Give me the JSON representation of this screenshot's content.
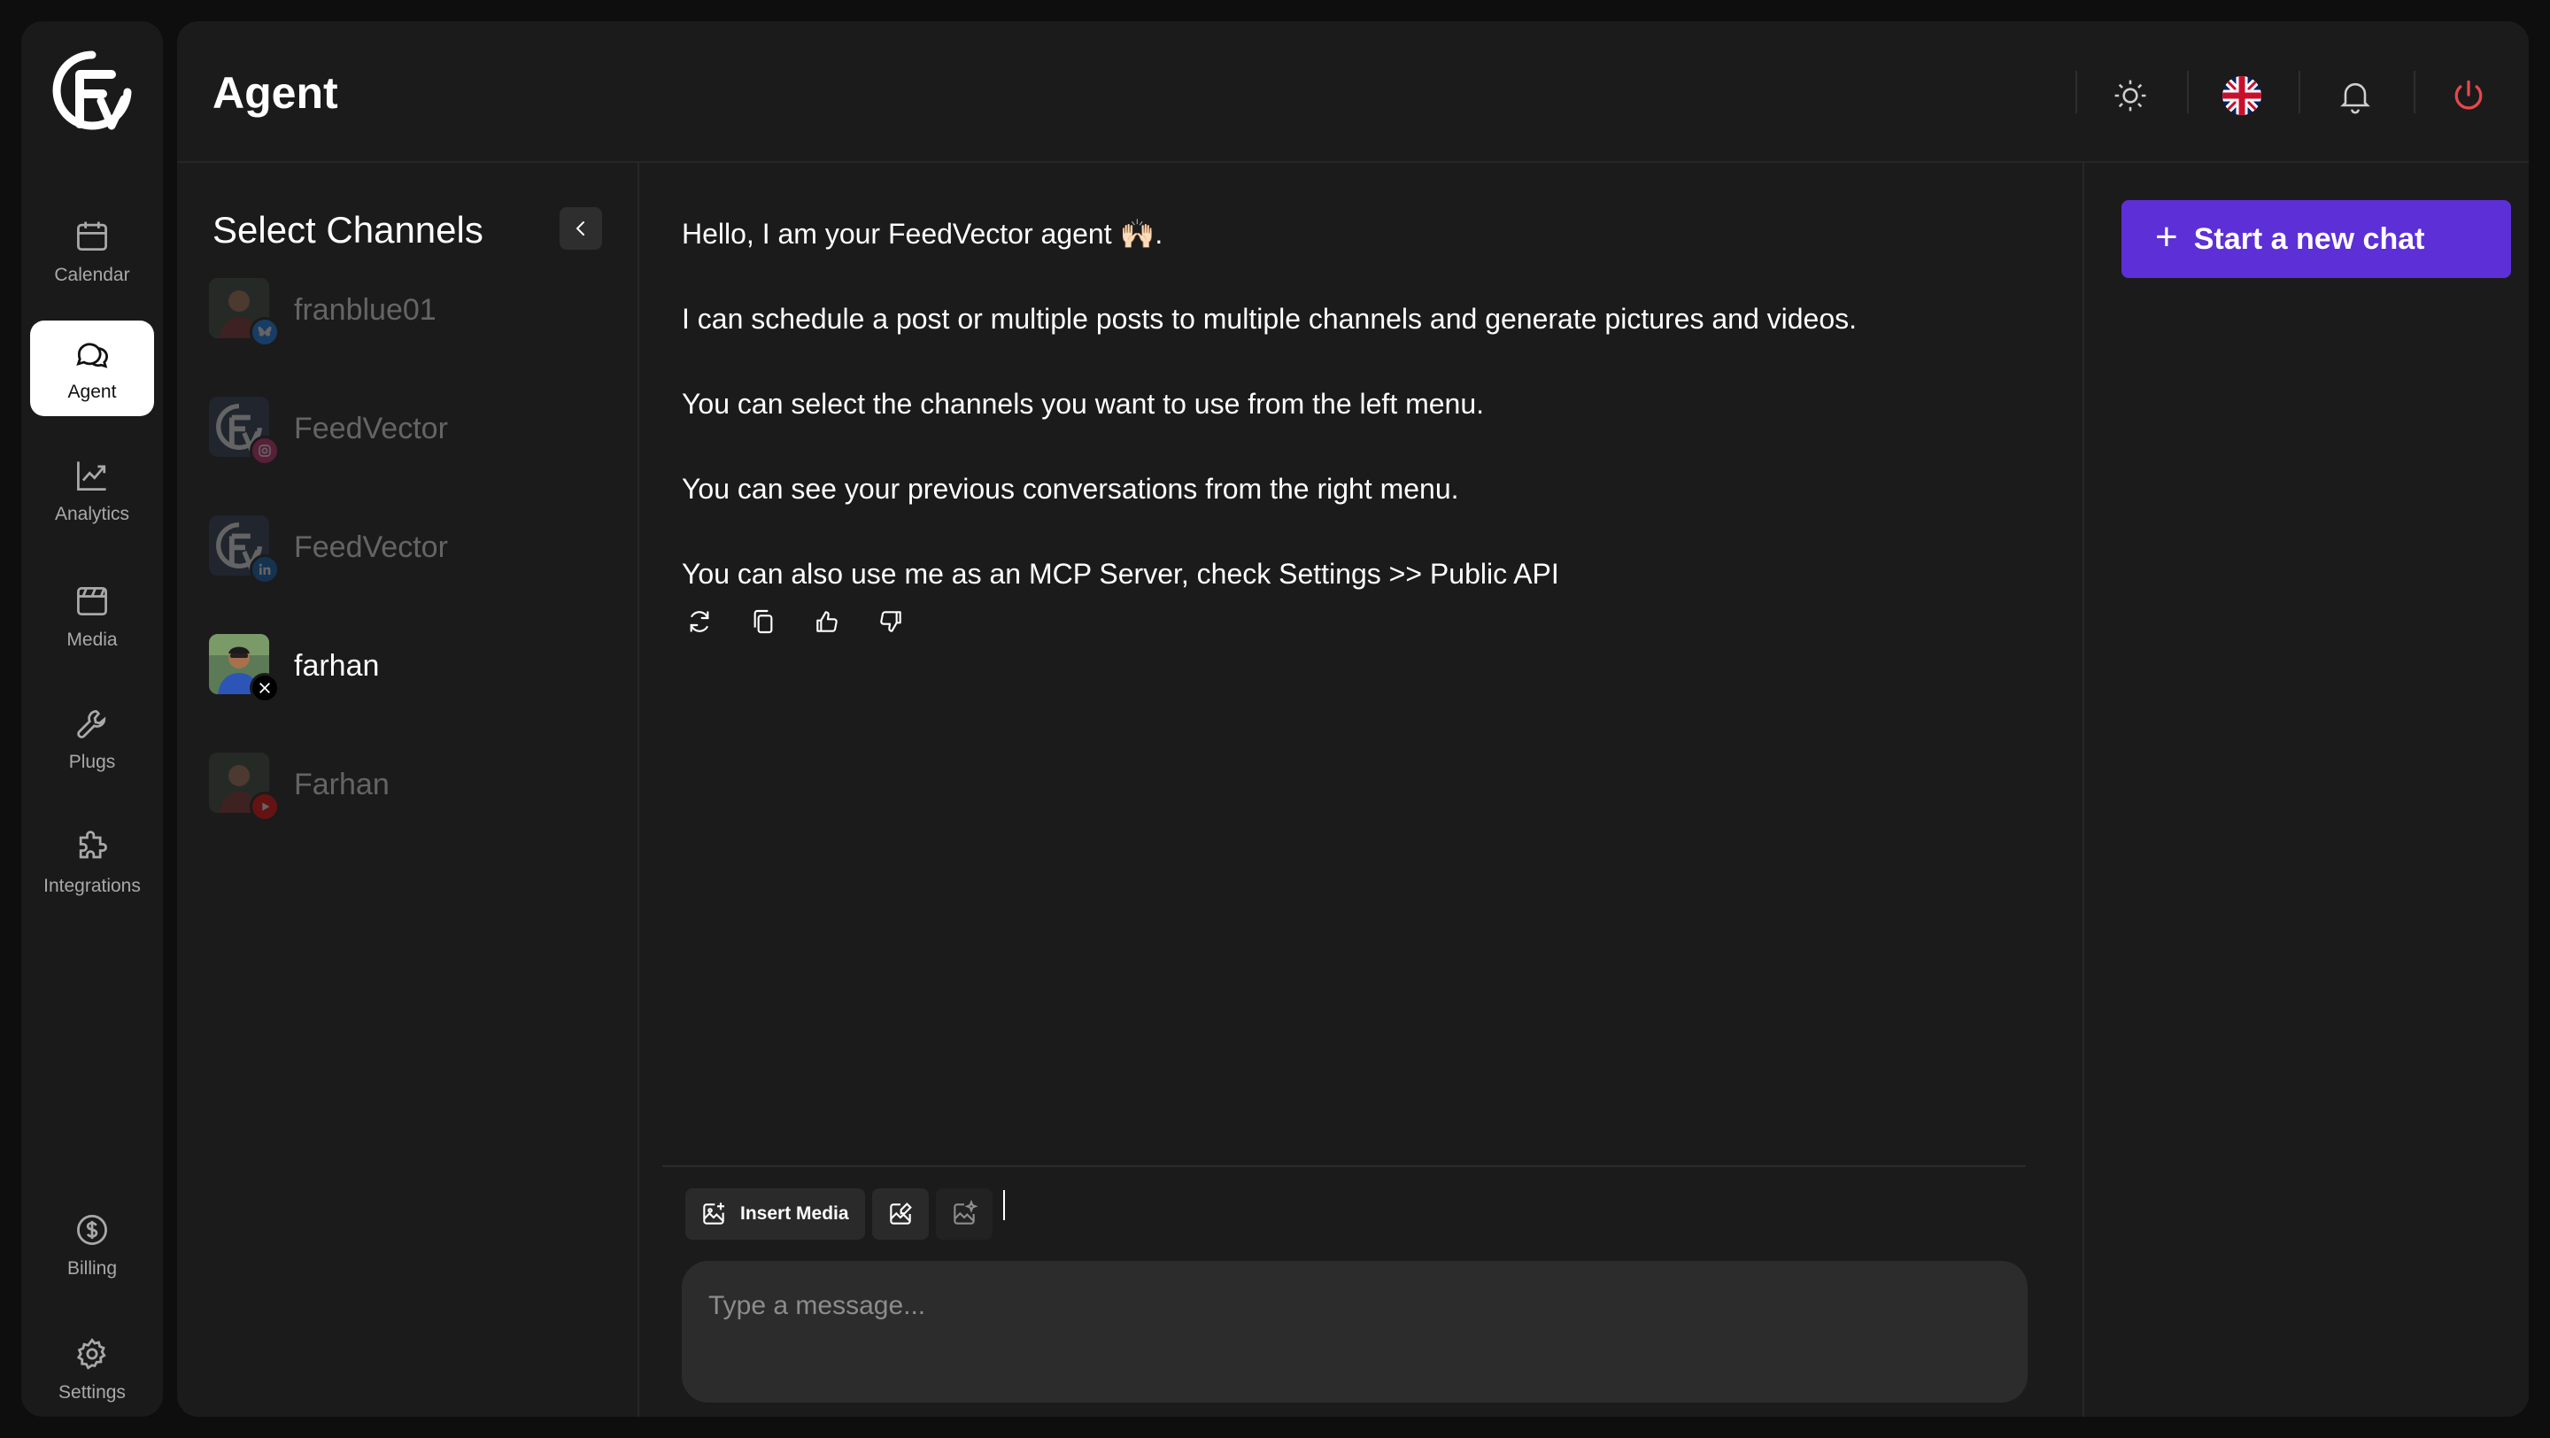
{
  "nav": {
    "items": [
      {
        "id": "calendar",
        "label": "Calendar",
        "icon": "calendar-icon",
        "active": false
      },
      {
        "id": "agent",
        "label": "Agent",
        "icon": "chat-bubbles-icon",
        "active": true
      },
      {
        "id": "analytics",
        "label": "Analytics",
        "icon": "chart-line-icon",
        "active": false
      },
      {
        "id": "media",
        "label": "Media",
        "icon": "media-icon",
        "active": false
      },
      {
        "id": "plugs",
        "label": "Plugs",
        "icon": "wrench-icon",
        "active": false
      },
      {
        "id": "integrations",
        "label": "Integrations",
        "icon": "puzzle-icon",
        "active": false
      }
    ],
    "bottom_items": [
      {
        "id": "billing",
        "label": "Billing",
        "icon": "dollar-circle-icon"
      },
      {
        "id": "settings",
        "label": "Settings",
        "icon": "gear-icon"
      }
    ]
  },
  "header": {
    "title": "Agent",
    "icons": [
      "sun-icon",
      "uk-flag-icon",
      "bell-icon",
      "power-icon"
    ],
    "power_color": "#e5484d"
  },
  "channels": {
    "title": "Select Channels",
    "items": [
      {
        "name": "franblue01",
        "network": "bluesky",
        "selected": false
      },
      {
        "name": "FeedVector",
        "network": "instagram",
        "selected": false
      },
      {
        "name": "FeedVector",
        "network": "linkedin",
        "selected": false
      },
      {
        "name": "farhan",
        "network": "x",
        "selected": true
      },
      {
        "name": "Farhan",
        "network": "youtube",
        "selected": false
      }
    ]
  },
  "chat": {
    "messages": [
      "Hello, I am your FeedVector agent 🙌🏻.",
      "I can schedule a post or multiple posts to multiple channels and generate pictures and videos.",
      "You can select the channels you want to use from the left menu.",
      "You can see your previous conversations from the right menu.",
      "You can also use me as an MCP Server, check Settings >> Public API"
    ],
    "actions": [
      "refresh-icon",
      "copy-icon",
      "thumbs-up-icon",
      "thumbs-down-icon"
    ],
    "toolbar": {
      "insert_media_label": "Insert Media"
    },
    "input": {
      "placeholder": "Type a message...",
      "value": ""
    }
  },
  "history": {
    "new_chat_label": "Start a new chat"
  },
  "colors": {
    "accent": "#5d2fd6",
    "background": "#0e0e0e",
    "panel": "#1b1b1b",
    "danger": "#e5484d"
  }
}
